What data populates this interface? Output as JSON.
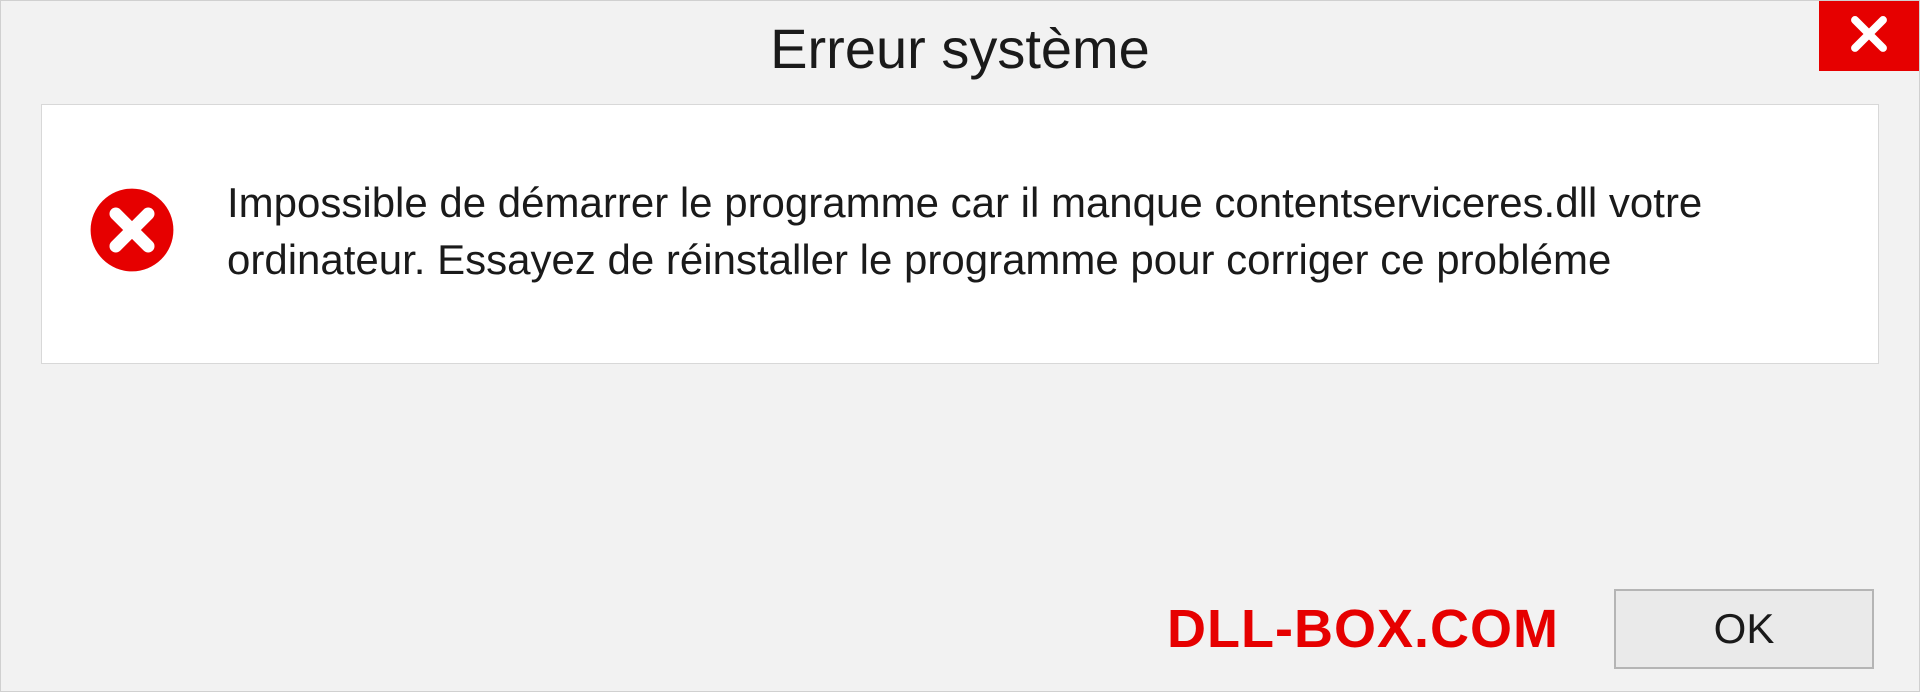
{
  "dialog": {
    "title": "Erreur système",
    "message": "Impossible de démarrer le programme car il manque contentserviceres.dll votre ordinateur. Essayez de réinstaller le programme pour corriger ce probléme",
    "ok_label": "OK",
    "brand": "DLL-BOX.COM"
  },
  "colors": {
    "accent_red": "#e60000",
    "panel_bg": "#ffffff",
    "dialog_bg": "#f2f2f2"
  },
  "icons": {
    "close": "close-icon",
    "error": "error-circle-x-icon"
  }
}
